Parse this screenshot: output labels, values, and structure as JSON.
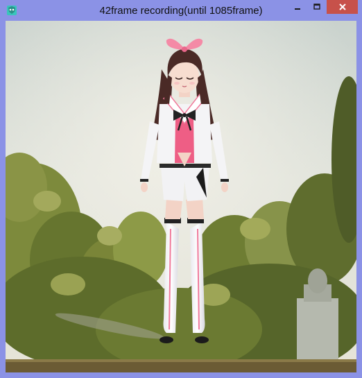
{
  "window": {
    "title": "42frame recording(until 1085frame)",
    "app_icon": "mmd-app-icon",
    "controls": {
      "minimize_icon": "minimize-icon",
      "maximize_icon": "maximize-icon",
      "close_icon": "close-icon"
    },
    "colors": {
      "frame": "#8b92e6",
      "close_button": "#c7514a"
    }
  },
  "viewport": {
    "content": "3d-render-character-scene"
  }
}
